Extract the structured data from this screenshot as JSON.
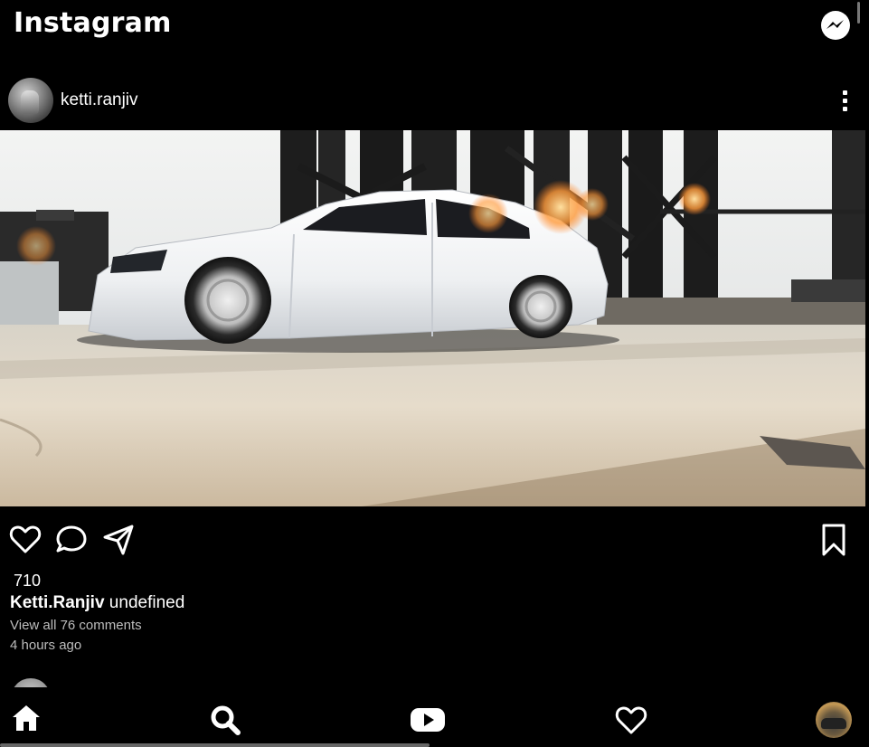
{
  "app": {
    "title": "Instagram"
  },
  "header": {
    "brand": "Instagram",
    "messenger_icon": "messenger-icon"
  },
  "post": {
    "username": "ketti.ranjiv",
    "image_alt": "White sedan parked under industrial structure",
    "likes": "710",
    "caption_user": "Ketti.Ranjiv",
    "caption_text": " undefined",
    "view_comments": "View all 76 comments",
    "time_ago": "4 hours ago"
  },
  "actions": {
    "like_icon": "heart-icon",
    "comment_icon": "comment-icon",
    "share_icon": "send-icon",
    "save_icon": "bookmark-icon"
  },
  "bottom_nav": {
    "items": [
      {
        "name": "home",
        "icon": "home-icon"
      },
      {
        "name": "search",
        "icon": "search-icon"
      },
      {
        "name": "reels",
        "icon": "play-icon"
      },
      {
        "name": "activity",
        "icon": "heart-icon"
      },
      {
        "name": "profile",
        "icon": "avatar"
      }
    ]
  },
  "colors": {
    "background": "#000000",
    "text": "#ffffff",
    "muted": "#bdbdbd"
  }
}
